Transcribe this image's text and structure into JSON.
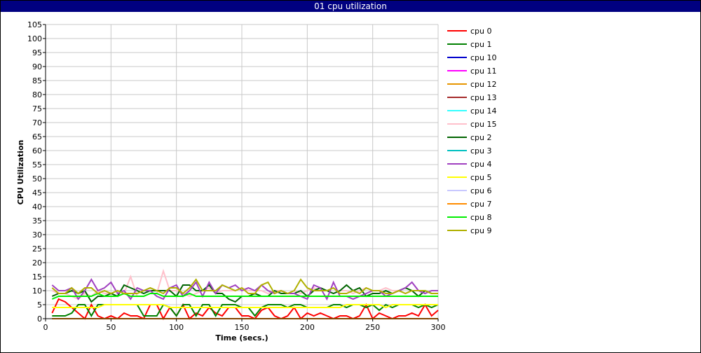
{
  "window": {
    "title": "01 cpu utilization"
  },
  "chart_data": {
    "type": "line",
    "title": "01 cpu utilization",
    "xlabel": "Time (secs.)",
    "ylabel": "CPU Utilization",
    "xlim": [
      0,
      300
    ],
    "ylim": [
      0,
      105
    ],
    "xticks": [
      0,
      50,
      100,
      150,
      200,
      250,
      300
    ],
    "yticks": [
      0,
      5,
      10,
      15,
      20,
      25,
      30,
      35,
      40,
      45,
      50,
      55,
      60,
      65,
      70,
      75,
      80,
      85,
      90,
      95,
      100,
      105
    ],
    "grid": true,
    "legend_position": "right",
    "x": [
      5,
      10,
      15,
      20,
      25,
      30,
      35,
      40,
      45,
      50,
      55,
      60,
      65,
      70,
      75,
      80,
      85,
      90,
      95,
      100,
      105,
      110,
      115,
      120,
      125,
      130,
      135,
      140,
      145,
      150,
      155,
      160,
      165,
      170,
      175,
      180,
      185,
      190,
      195,
      200,
      205,
      210,
      215,
      220,
      225,
      230,
      235,
      240,
      245,
      250,
      255,
      260,
      265,
      270,
      275,
      280,
      285,
      290,
      295,
      300
    ],
    "series": [
      {
        "name": "cpu 0",
        "color": "#ff0000",
        "values": [
          2,
          7,
          6,
          4,
          2,
          0,
          5,
          1,
          0,
          1,
          0,
          2,
          1,
          1,
          0,
          5,
          5,
          0,
          4,
          1,
          5,
          0,
          2,
          1,
          4,
          2,
          1,
          4,
          4,
          1,
          1,
          0,
          3,
          4,
          1,
          0,
          1,
          4,
          0,
          2,
          1,
          2,
          1,
          0,
          1,
          1,
          0,
          1,
          5,
          0,
          2,
          1,
          0,
          1,
          1,
          2,
          1,
          5,
          1,
          3
        ]
      },
      {
        "name": "cpu 1",
        "color": "#008000",
        "values": [
          1,
          1,
          1,
          2,
          5,
          5,
          1,
          5,
          5,
          5,
          5,
          5,
          5,
          5,
          1,
          1,
          1,
          5,
          4,
          1,
          5,
          5,
          1,
          5,
          5,
          1,
          5,
          5,
          5,
          4,
          4,
          1,
          4,
          5,
          5,
          5,
          4,
          5,
          5,
          4,
          4,
          4,
          4,
          5,
          5,
          4,
          5,
          5,
          4,
          5,
          3,
          5,
          4,
          5,
          5,
          5,
          4,
          5,
          4,
          5
        ]
      },
      {
        "name": "cpu 10",
        "color": "#0000cc",
        "values": [
          0,
          0,
          0,
          0,
          0,
          0,
          0,
          0,
          0,
          0,
          0,
          0,
          0,
          0,
          0,
          0,
          0,
          0,
          0,
          0,
          0,
          0,
          0,
          0,
          0,
          0,
          0,
          0,
          0,
          0,
          0,
          0,
          0,
          0,
          0,
          0,
          0,
          0,
          0,
          0,
          0,
          0,
          0,
          0,
          0,
          0,
          0,
          0,
          0,
          0,
          0,
          0,
          0,
          0,
          0,
          0,
          0,
          0,
          0,
          0
        ]
      },
      {
        "name": "cpu 11",
        "color": "#ff00ff",
        "values": [
          0,
          0,
          0,
          0,
          0,
          0,
          0,
          0,
          0,
          0,
          0,
          0,
          0,
          0,
          0,
          0,
          0,
          0,
          0,
          0,
          0,
          0,
          0,
          0,
          0,
          0,
          0,
          0,
          0,
          0,
          0,
          0,
          0,
          0,
          0,
          0,
          0,
          0,
          0,
          0,
          0,
          0,
          0,
          0,
          0,
          0,
          0,
          0,
          0,
          0,
          0,
          0,
          0,
          0,
          0,
          0,
          0,
          0,
          0,
          0
        ]
      },
      {
        "name": "cpu 12",
        "color": "#e69500",
        "values": [
          0,
          0,
          0,
          0,
          0,
          0,
          0,
          0,
          0,
          0,
          0,
          0,
          0,
          0,
          0,
          0,
          0,
          0,
          0,
          0,
          0,
          0,
          0,
          0,
          0,
          0,
          0,
          0,
          0,
          0,
          0,
          0,
          0,
          0,
          0,
          0,
          0,
          0,
          0,
          0,
          0,
          0,
          0,
          0,
          0,
          0,
          0,
          0,
          0,
          0,
          0,
          0,
          0,
          0,
          0,
          0,
          0,
          0,
          0,
          0
        ]
      },
      {
        "name": "cpu 13",
        "color": "#a52a2a",
        "values": [
          0,
          0,
          0,
          0,
          0,
          0,
          0,
          0,
          0,
          0,
          0,
          0,
          0,
          0,
          0,
          0,
          0,
          0,
          0,
          0,
          0,
          0,
          0,
          0,
          0,
          0,
          0,
          0,
          0,
          0,
          0,
          0,
          0,
          0,
          0,
          0,
          0,
          0,
          0,
          0,
          0,
          0,
          0,
          0,
          0,
          0,
          0,
          0,
          0,
          0,
          0,
          0,
          0,
          0,
          0,
          0,
          0,
          0,
          0,
          0
        ]
      },
      {
        "name": "cpu 14",
        "color": "#33ffff",
        "values": [
          0,
          0,
          0,
          0,
          0,
          0,
          0,
          0,
          0,
          0,
          0,
          0,
          0,
          0,
          0,
          0,
          0,
          0,
          0,
          0,
          0,
          0,
          0,
          0,
          0,
          0,
          0,
          0,
          0,
          0,
          0,
          0,
          0,
          0,
          0,
          0,
          0,
          0,
          0,
          0,
          0,
          0,
          0,
          0,
          0,
          0,
          0,
          0,
          0,
          0,
          0,
          0,
          0,
          0,
          0,
          0,
          0,
          0,
          0,
          0
        ]
      },
      {
        "name": "cpu 15",
        "color": "#ffc0cb",
        "values": [
          10,
          9,
          9,
          8,
          7,
          9,
          8,
          10,
          9,
          9,
          8,
          9,
          15,
          8,
          8,
          9,
          9,
          17,
          10,
          10,
          9,
          8,
          9,
          10,
          11,
          9,
          10,
          10,
          10,
          11,
          10,
          10,
          10,
          9,
          10,
          10,
          9,
          10,
          9,
          10,
          11,
          10,
          10,
          9,
          10,
          10,
          9,
          10,
          11,
          10,
          10,
          11,
          10,
          10,
          9,
          10,
          10,
          9,
          10,
          10
        ]
      },
      {
        "name": "cpu 2",
        "color": "#006400",
        "values": [
          8,
          9,
          9,
          10,
          9,
          10,
          6,
          8,
          8,
          9,
          8,
          12,
          11,
          10,
          9,
          10,
          10,
          10,
          10,
          8,
          12,
          12,
          10,
          10,
          12,
          9,
          9,
          7,
          6,
          8,
          8,
          9,
          8,
          8,
          10,
          9,
          9,
          9,
          10,
          8,
          10,
          11,
          10,
          9,
          10,
          12,
          10,
          11,
          8,
          9,
          9,
          10,
          9,
          10,
          11,
          10,
          8,
          10,
          9,
          9
        ]
      },
      {
        "name": "cpu 3",
        "color": "#00c0c0",
        "values": [
          0,
          0,
          0,
          0,
          0,
          0,
          0,
          0,
          0,
          0,
          0,
          0,
          0,
          0,
          0,
          0,
          0,
          0,
          0,
          0,
          0,
          0,
          0,
          0,
          0,
          0,
          0,
          0,
          0,
          0,
          0,
          0,
          0,
          0,
          0,
          0,
          0,
          0,
          0,
          0,
          0,
          0,
          0,
          0,
          0,
          0,
          0,
          0,
          0,
          0,
          0,
          0,
          0,
          0,
          0,
          0,
          0,
          0,
          0,
          0
        ]
      },
      {
        "name": "cpu 4",
        "color": "#a040c0",
        "values": [
          12,
          10,
          10,
          11,
          7,
          10,
          14,
          10,
          11,
          13,
          9,
          10,
          7,
          11,
          10,
          10,
          8,
          7,
          11,
          12,
          8,
          10,
          13,
          8,
          13,
          9,
          12,
          11,
          12,
          10,
          11,
          10,
          12,
          10,
          9,
          10,
          9,
          9,
          8,
          7,
          12,
          11,
          7,
          13,
          8,
          8,
          7,
          8,
          9,
          10,
          10,
          8,
          9,
          10,
          11,
          13,
          10,
          9,
          10,
          10
        ]
      },
      {
        "name": "cpu 5",
        "color": "#ffff00",
        "values": [
          4,
          4,
          4,
          4,
          4,
          4,
          4,
          4,
          5,
          5,
          5,
          5,
          5,
          5,
          5,
          5,
          5,
          5,
          4,
          4,
          4,
          4,
          4,
          4,
          4,
          4,
          4,
          4,
          4,
          4,
          4,
          4,
          4,
          4,
          4,
          4,
          4,
          4,
          4,
          4,
          4,
          4,
          4,
          4,
          4,
          5,
          5,
          5,
          5,
          5,
          5,
          4,
          5,
          5,
          5,
          5,
          5,
          5,
          5,
          5
        ]
      },
      {
        "name": "cpu 6",
        "color": "#c8c8ff",
        "values": [
          0,
          0,
          0,
          0,
          0,
          0,
          0,
          0,
          0,
          0,
          0,
          0,
          0,
          0,
          0,
          0,
          0,
          0,
          0,
          0,
          0,
          0,
          0,
          0,
          0,
          0,
          0,
          0,
          0,
          0,
          0,
          0,
          0,
          0,
          0,
          0,
          0,
          0,
          0,
          0,
          0,
          0,
          0,
          0,
          0,
          0,
          0,
          0,
          0,
          0,
          0,
          0,
          0,
          0,
          0,
          0,
          0,
          0,
          0,
          0
        ]
      },
      {
        "name": "cpu 7",
        "color": "#ff8c00",
        "values": [
          0,
          0,
          0,
          0,
          0,
          0,
          0,
          0,
          0,
          0,
          0,
          0,
          0,
          0,
          0,
          0,
          0,
          0,
          0,
          0,
          0,
          0,
          0,
          0,
          0,
          0,
          0,
          0,
          0,
          0,
          0,
          0,
          0,
          0,
          0,
          0,
          0,
          0,
          0,
          0,
          0,
          0,
          0,
          0,
          0,
          0,
          0,
          0,
          0,
          0,
          0,
          0,
          0,
          0,
          0,
          0,
          0,
          0,
          0,
          0
        ]
      },
      {
        "name": "cpu 8",
        "color": "#00ee00",
        "values": [
          7,
          8,
          8,
          8,
          8,
          8,
          8,
          9,
          8,
          8,
          8,
          9,
          8,
          8,
          8,
          9,
          9,
          8,
          8,
          8,
          8,
          9,
          8,
          8,
          8,
          8,
          8,
          8,
          8,
          8,
          8,
          8,
          8,
          8,
          8,
          8,
          8,
          8,
          8,
          8,
          8,
          8,
          8,
          8,
          8,
          8,
          8,
          8,
          8,
          8,
          8,
          8,
          8,
          8,
          8,
          8,
          8,
          8,
          8,
          8
        ]
      },
      {
        "name": "cpu 9",
        "color": "#b0b000",
        "values": [
          11,
          9,
          9,
          11,
          9,
          11,
          11,
          9,
          10,
          9,
          10,
          9,
          9,
          9,
          10,
          11,
          10,
          9,
          11,
          11,
          9,
          11,
          14,
          10,
          10,
          10,
          12,
          11,
          10,
          11,
          9,
          9,
          12,
          13,
          9,
          10,
          9,
          10,
          14,
          11,
          10,
          10,
          10,
          11,
          9,
          9,
          10,
          9,
          11,
          10,
          10,
          9,
          9,
          10,
          9,
          10,
          10,
          10,
          9,
          9
        ]
      }
    ]
  }
}
